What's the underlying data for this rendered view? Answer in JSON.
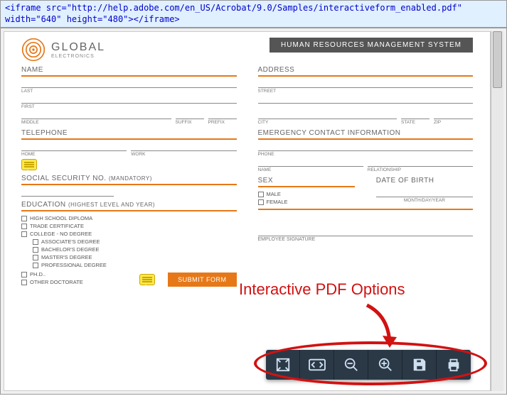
{
  "code_snippet": "<iframe src=\"http://help.adobe.com/en_US/Acrobat/9.0/Samples/interactiveform_enabled.pdf\" width=\"640\" height=\"480\"></iframe>",
  "logo": {
    "brand": "GLOBAL",
    "sub": "ELECTRONICS"
  },
  "hr_banner": "HUMAN RESOURCES MANAGEMENT SYSTEM",
  "sections": {
    "name": {
      "title": "NAME",
      "last": "LAST",
      "first": "FIRST",
      "middle": "MIDDLE",
      "suffix": "SUFFIX",
      "prefix": "PREFIX"
    },
    "address": {
      "title": "ADDRESS",
      "street": "STREET",
      "city": "CITY",
      "state": "STATE",
      "zip": "ZIP"
    },
    "telephone": {
      "title": "TELEPHONE",
      "home": "HOME",
      "work": "WORK"
    },
    "emergency": {
      "title": "EMERGENCY CONTACT INFORMATION",
      "phone": "PHONE",
      "name": "NAME",
      "relationship": "RELATIONSHIP"
    },
    "ssn": {
      "title": "SOCIAL SECURITY NO.",
      "mandatory": "(MANDATORY)"
    },
    "sex": {
      "title": "SEX",
      "male": "MALE",
      "female": "FEMALE"
    },
    "dob": {
      "title": "DATE OF BIRTH",
      "hint": "MONTH/DAY/YEAR"
    },
    "education": {
      "title": "EDUCATION",
      "sub": "(HIGHEST LEVEL AND YEAR)",
      "hs": "HIGH SCHOOL DIPLOMA",
      "trade": "TRADE CERTIFICATE",
      "college": "COLLEGE - NO DEGREE",
      "assoc": "ASSOCIATE'S DEGREE",
      "bach": "BACHELOR'S DEGREE",
      "mast": "MASTER'S DEGREE",
      "prof": "PROFESSIONAL DEGREE",
      "phd": "PH.D..",
      "other": "OTHER DOCTORATE"
    },
    "signature": "EMPLOYEE SIGNATURE"
  },
  "submit_label": "SUBMIT FORM",
  "annotation": "Interactive PDF Options",
  "toolbar": {
    "fit": "fit-page",
    "pager": "page-nav",
    "zoom_out": "zoom-out",
    "zoom_in": "zoom-in",
    "save": "save",
    "print": "print"
  }
}
